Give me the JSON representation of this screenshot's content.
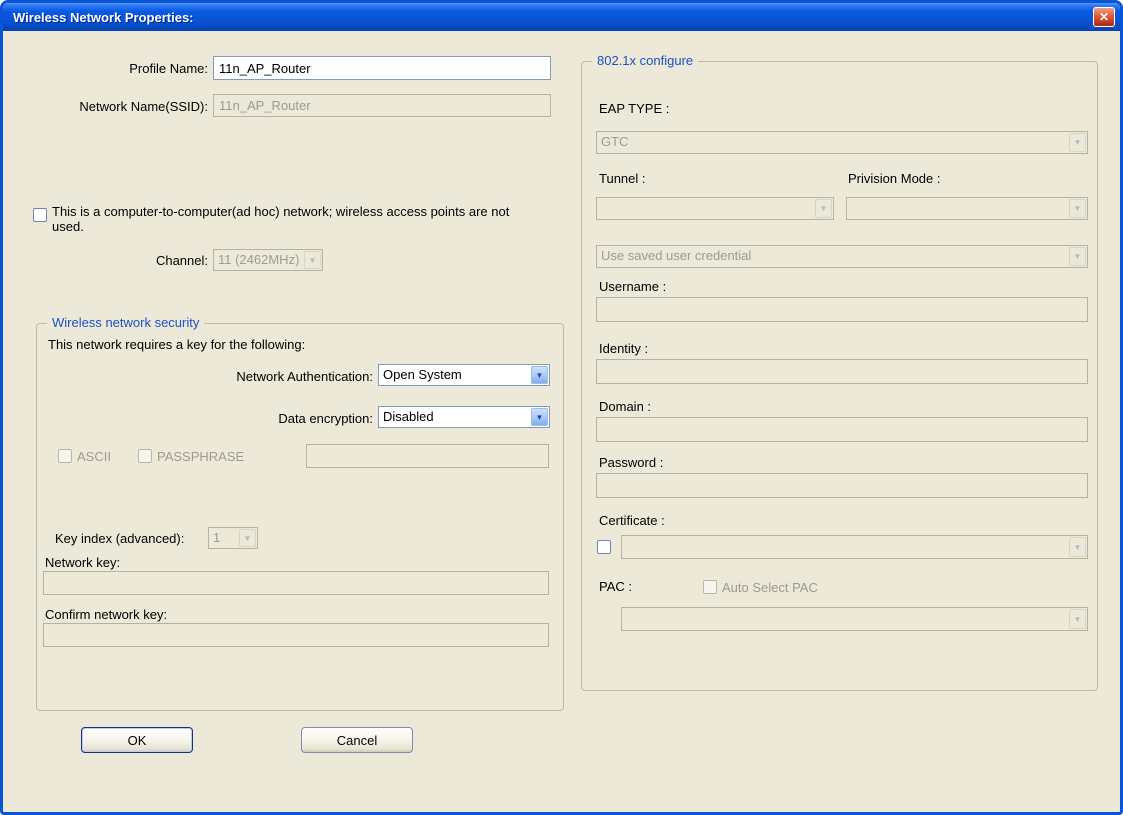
{
  "colors": {
    "titlebar_top": "#2F7CF6",
    "titlebar_bottom": "#0646B4",
    "dialog_bg": "#ECE9D8",
    "group_title_blue": "#1E50C8",
    "close_button_red": "#D8492A",
    "disabled_text": "#9E9C8F",
    "enabled_border": "#7F9DB9"
  },
  "titlebar": {
    "title": "Wireless Network Properties:",
    "close": "✕"
  },
  "profile": {
    "label": "Profile Name:",
    "value": "11n_AP_Router"
  },
  "ssid": {
    "label": "Network Name(SSID):",
    "value": "11n_AP_Router"
  },
  "adhoc": {
    "label": "This is a computer-to-computer(ad hoc) network; wireless access points are not used.",
    "checked": false
  },
  "channel": {
    "label": "Channel:",
    "value": "11 (2462MHz)"
  },
  "security": {
    "title": "Wireless network security",
    "intro": "This network requires a key for the following:",
    "network_auth": {
      "label": "Network Authentication:",
      "value": "Open System"
    },
    "data_encryption": {
      "label": "Data encryption:",
      "value": "Disabled"
    },
    "ascii_label": "ASCII",
    "passphrase_label": "PASSPHRASE",
    "passphrase_value": "",
    "key_index": {
      "label": "Key index (advanced):",
      "value": "1"
    },
    "network_key": {
      "label": "Network key:",
      "value": ""
    },
    "confirm_key": {
      "label": "Confirm network key:",
      "value": ""
    }
  },
  "actions": {
    "ok": "OK",
    "cancel": "Cancel"
  },
  "ieee8021x": {
    "title": "802.1x configure",
    "eap_type_label": "EAP TYPE :",
    "eap_type_value": "GTC",
    "tunnel_label": "Tunnel :",
    "tunnel_value": "",
    "privision_label": "Privision Mode :",
    "privision_value": "",
    "credential_value": "Use saved user credential",
    "username_label": "Username :",
    "username_value": "",
    "identity_label": "Identity :",
    "identity_value": "",
    "domain_label": "Domain :",
    "domain_value": "",
    "password_label": "Password :",
    "password_value": "",
    "certificate_label": "Certificate :",
    "certificate_value": "",
    "pac_label": "PAC :",
    "auto_select_pac_label": "Auto Select PAC",
    "pac_value": ""
  }
}
